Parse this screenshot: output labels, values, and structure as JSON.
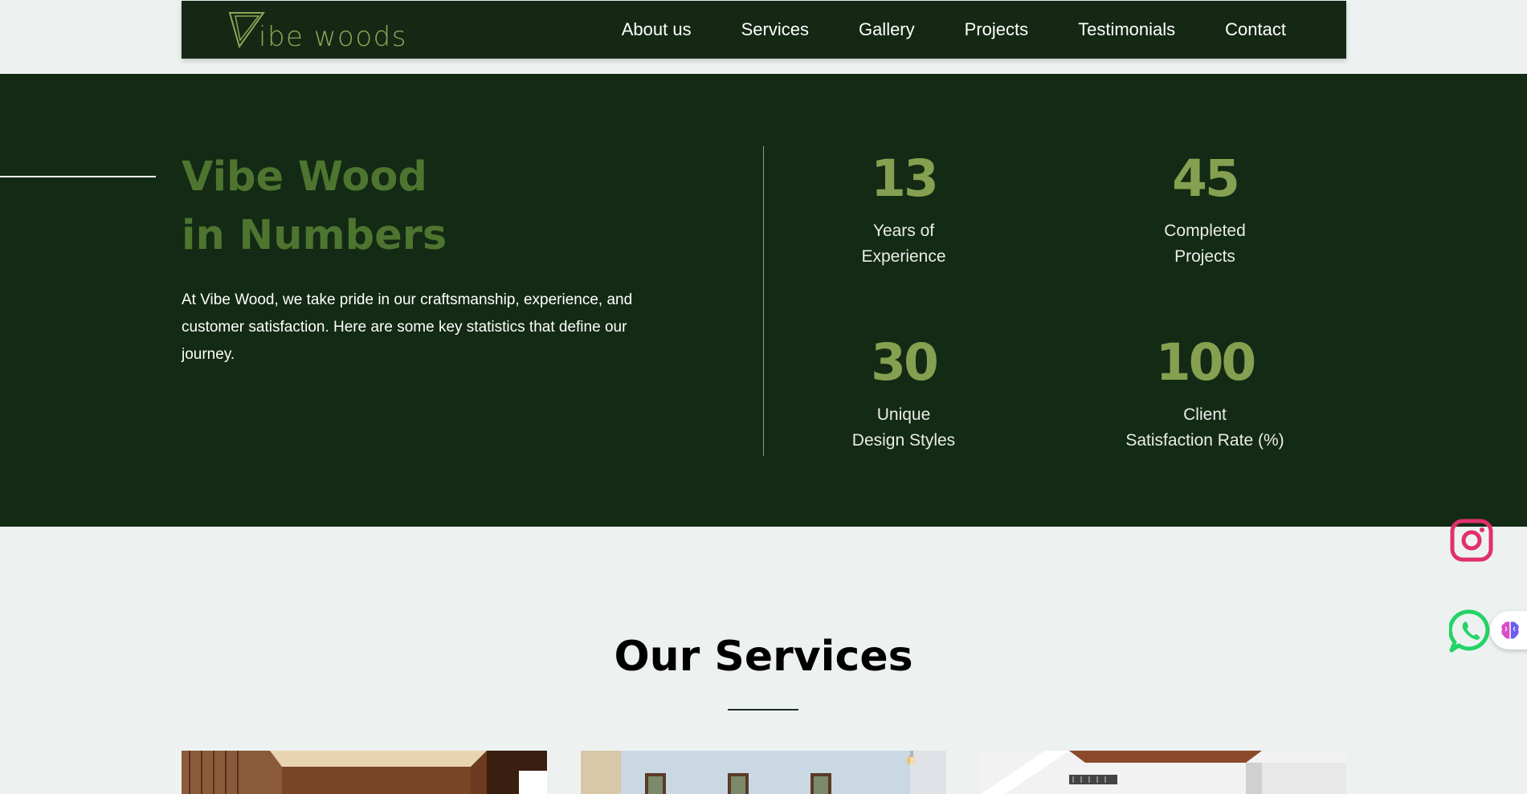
{
  "navbar": {
    "logo_text": "ibe woods",
    "links": [
      "About us",
      "Services",
      "Gallery",
      "Projects",
      "Testimonials",
      "Contact"
    ]
  },
  "stats_section": {
    "title_line1": "Vibe Wood",
    "title_line2": "in Numbers",
    "description": "At Vibe Wood, we take pride in our craftsmanship, experience, and customer satisfaction. Here are some key statistics that define our journey.",
    "items": [
      {
        "number": "13",
        "label_line1": "Years of",
        "label_line2": "Experience"
      },
      {
        "number": "45",
        "label_line1": "Completed",
        "label_line2": "Projects"
      },
      {
        "number": "30",
        "label_line1": "Unique",
        "label_line2": "Design Styles"
      },
      {
        "number": "100",
        "label_line1": "Client",
        "label_line2": "Satisfaction Rate (%)"
      }
    ]
  },
  "services": {
    "title": "Our Services"
  },
  "floating": {
    "icons": [
      "instagram-icon",
      "whatsapp-icon",
      "brain-icon"
    ]
  },
  "colors": {
    "dark_green": "#132a14",
    "accent_green": "#4e7530",
    "number_green": "#85a050",
    "page_bg": "#edf2f1"
  }
}
